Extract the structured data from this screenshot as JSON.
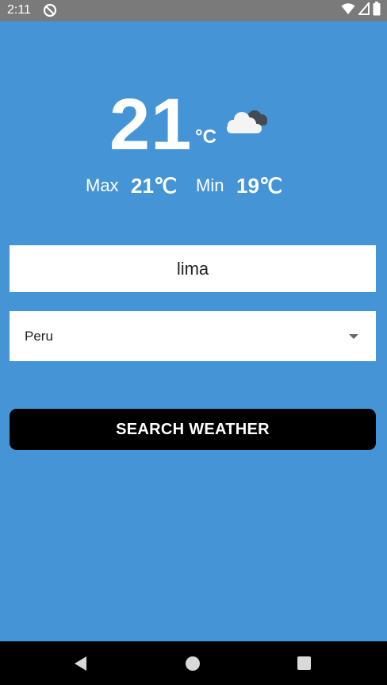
{
  "status_bar": {
    "time": "2:11",
    "icons": [
      "app-notification-icon",
      "wifi-icon",
      "signal-icon",
      "battery-icon"
    ]
  },
  "weather": {
    "temperature": "21",
    "unit": "°C",
    "condition_icon": "cloudy-icon",
    "max_label": "Max",
    "max_value": "21℃",
    "min_label": "Min",
    "min_value": "19℃"
  },
  "form": {
    "city_value": "lima",
    "country_value": "Peru",
    "search_button_label": "SEARCH WEATHER"
  },
  "nav_bar": {
    "icons": [
      "back-icon",
      "home-icon",
      "recents-icon"
    ]
  },
  "colors": {
    "background": "#4595d6",
    "status_bar": "#7a7a7a",
    "button": "#000000",
    "text_on_primary": "#ffffff"
  }
}
